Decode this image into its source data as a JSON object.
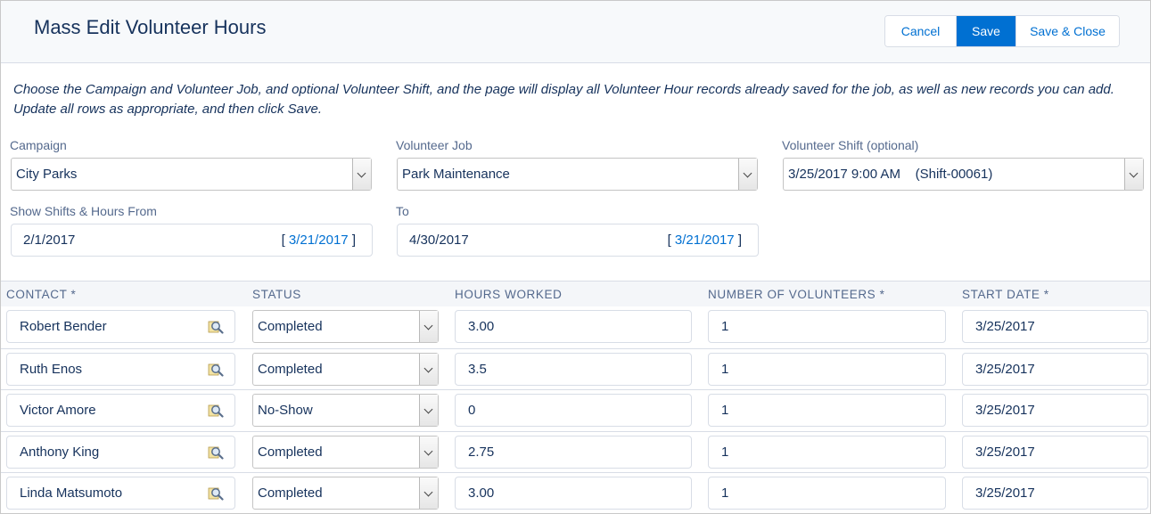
{
  "page_title": "Mass Edit Volunteer Hours",
  "buttons": {
    "cancel": "Cancel",
    "save": "Save",
    "save_close": "Save & Close"
  },
  "instructions_line1": "Choose the Campaign and Volunteer Job, and optional Volunteer Shift, and the page will display all Volunteer Hour records already saved for the job, as well as new records you can add.",
  "instructions_line2": "Update all rows as appropriate, and then click Save.",
  "filters": {
    "campaign": {
      "label": "Campaign",
      "value": "City Parks"
    },
    "job": {
      "label": "Volunteer Job",
      "value": "Park Maintenance"
    },
    "shift": {
      "label": "Volunteer Shift (optional)",
      "value": "3/25/2017 9:00 AM    (Shift-00061)"
    },
    "from": {
      "label": "Show Shifts & Hours From",
      "value": "2/1/2017",
      "today": "3/21/2017"
    },
    "to": {
      "label": "To",
      "value": "4/30/2017",
      "today": "3/21/2017"
    }
  },
  "today_bracket_open": "[ ",
  "today_bracket_close": " ]",
  "columns": {
    "contact": "CONTACT *",
    "status": "STATUS",
    "hours": "HOURS WORKED",
    "volunteers": "NUMBER OF VOLUNTEERS *",
    "start_date": "START DATE *"
  },
  "icons": {
    "lookup": "magnifier-lookup-icon",
    "dropdown": "chevron-down-icon"
  },
  "accent_color": "#0070d2",
  "rows": [
    {
      "contact": "Robert Bender",
      "status": "Completed",
      "hours": "3.00",
      "volunteers": "1",
      "start_date": "3/25/2017"
    },
    {
      "contact": "Ruth Enos",
      "status": "Completed",
      "hours": "3.5",
      "volunteers": "1",
      "start_date": "3/25/2017"
    },
    {
      "contact": "Victor Amore",
      "status": "No-Show",
      "hours": "0",
      "volunteers": "1",
      "start_date": "3/25/2017"
    },
    {
      "contact": "Anthony King",
      "status": "Completed",
      "hours": "2.75",
      "volunteers": "1",
      "start_date": "3/25/2017"
    },
    {
      "contact": "Linda Matsumoto",
      "status": "Completed",
      "hours": "3.00",
      "volunteers": "1",
      "start_date": "3/25/2017"
    }
  ]
}
